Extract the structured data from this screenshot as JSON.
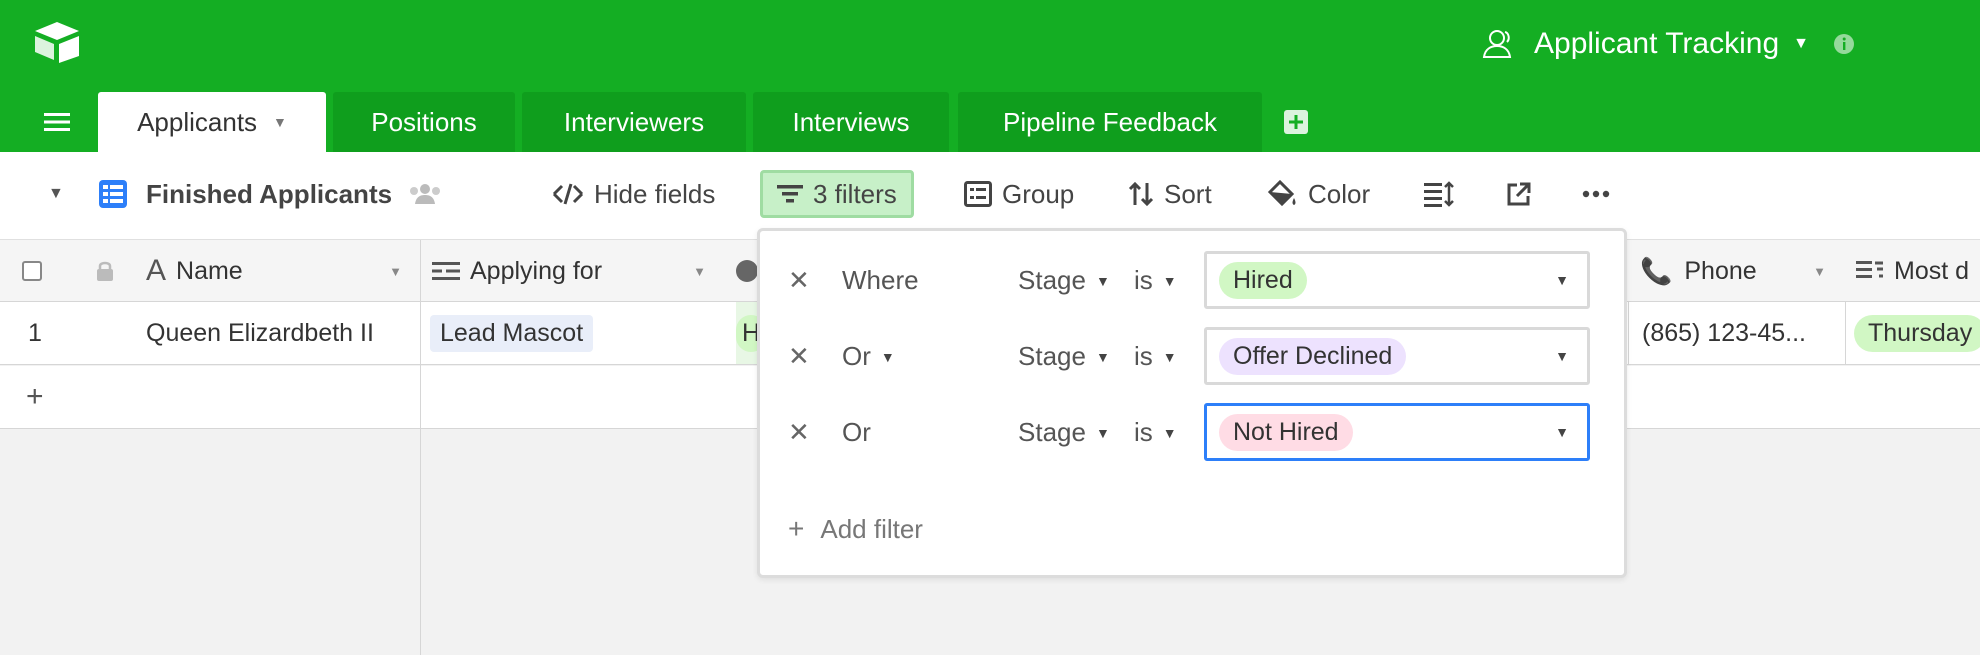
{
  "header": {
    "base_title": "Applicant Tracking",
    "icons": [
      "airtable-logo-icon",
      "user-icon",
      "chevron-down-icon",
      "info-icon"
    ]
  },
  "tabs": [
    {
      "label": "Applicants",
      "active": true
    },
    {
      "label": "Positions"
    },
    {
      "label": "Interviewers"
    },
    {
      "label": "Interviews"
    },
    {
      "label": "Pipeline Feedback"
    }
  ],
  "toolbar": {
    "view_name": "Finished Applicants",
    "hide_fields": "Hide fields",
    "filters": "3 filters",
    "group": "Group",
    "sort": "Sort",
    "color": "Color"
  },
  "grid": {
    "columns": [
      {
        "label": "Name"
      },
      {
        "label": "Applying for"
      },
      {
        "label": "Phone"
      },
      {
        "label": "Most d"
      }
    ],
    "rows": [
      {
        "number": "1",
        "name": "Queen Elizardbeth II",
        "applying_for": "Lead Mascot",
        "stage_partial": "H",
        "phone": "(865) 123-45...",
        "most_recent": "Thursday"
      }
    ],
    "add_row": "+"
  },
  "filters_popup": {
    "rows": [
      {
        "conjunction": "Where",
        "field": "Stage",
        "operator": "is",
        "value": "Hired",
        "value_bg": "#d1f7c4"
      },
      {
        "conjunction": "Or",
        "field": "Stage",
        "operator": "is",
        "value": "Offer Declined",
        "value_bg": "#ede2fe"
      },
      {
        "conjunction": "Or",
        "field": "Stage",
        "operator": "is",
        "value": "Not Hired",
        "value_bg": "#ffdce5"
      }
    ],
    "add_filter": "Add filter"
  },
  "colors": {
    "brand_green": "#14ae23",
    "focus_blue": "#2d7ff9",
    "filter_active_bg": "#c7f0c8",
    "view_icon_blue": "#2d7ff9"
  }
}
